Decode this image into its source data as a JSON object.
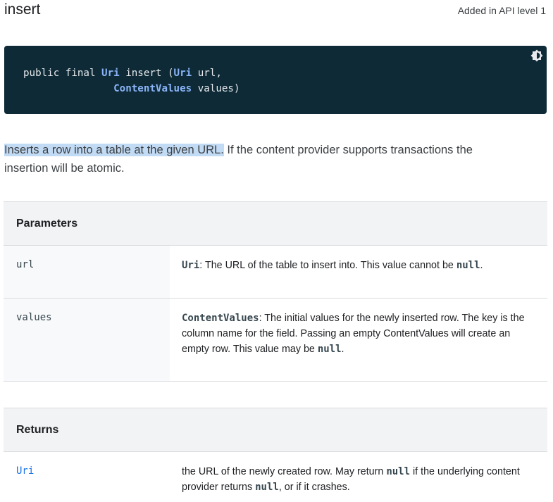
{
  "header": {
    "title": "insert",
    "api_level": "Added in API level 1"
  },
  "code": {
    "modifiers": "public final ",
    "return_type": "Uri",
    "method_prefix": " insert (",
    "param1_type": "Uri",
    "param1_name": " url,",
    "indent": "               ",
    "param2_type": "ContentValues",
    "param2_name": " values)",
    "theme_icon": "brightness-contrast-icon"
  },
  "description": {
    "highlighted": "Inserts a row into a table at the given URL.",
    "rest": " If the content provider supports transactions the insertion will be atomic."
  },
  "parameters": {
    "heading": "Parameters",
    "rows": [
      {
        "name": "url",
        "type": "Uri",
        "text": ": The URL of the table to insert into. This value cannot be ",
        "null": "null",
        "end": "."
      },
      {
        "name": "values",
        "type": "ContentValues",
        "text": ": The initial values for the newly inserted row. The key is the column name for the field. Passing an empty ContentValues will create an empty row. This value may be ",
        "null": "null",
        "end": "."
      }
    ]
  },
  "returns": {
    "heading": "Returns",
    "type": "Uri",
    "text1": "the URL of the newly created row. May return ",
    "null1": "null",
    "text2": " if the underlying content provider returns ",
    "null2": "null",
    "text3": ", or if it crashes."
  },
  "colors": {
    "code_background": "#0d2a36",
    "code_type": "#8ab4f8",
    "highlight": "#c2dbf5",
    "link": "#1a73e8"
  }
}
